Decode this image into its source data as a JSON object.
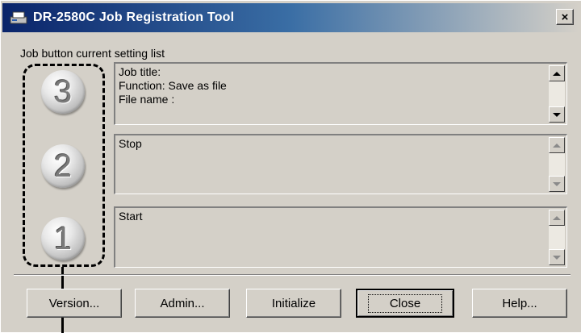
{
  "window": {
    "title": "DR-2580C Job Registration Tool",
    "close_glyph": "×"
  },
  "group": {
    "label": "Job button current setting list"
  },
  "job_buttons": [
    {
      "number": "3"
    },
    {
      "number": "2"
    },
    {
      "number": "1"
    }
  ],
  "panels": [
    {
      "lines": [
        "Job title:",
        "Function: Save as file",
        "File name :"
      ]
    },
    {
      "lines": [
        "Stop"
      ]
    },
    {
      "lines": [
        "Start"
      ]
    }
  ],
  "buttons": {
    "version": "Version...",
    "admin": "Admin...",
    "initialize": "Initialize",
    "close": "Close",
    "help": "Help..."
  },
  "colors": {
    "titlebar_start": "#0a246a",
    "titlebar_end": "#d4d0c8",
    "window_bg": "#d4d0c8"
  },
  "icons": {
    "app": "scanner-app-icon",
    "close": "close-icon",
    "scroll_up": "scroll-up-arrow-icon",
    "scroll_down": "scroll-down-arrow-icon"
  }
}
